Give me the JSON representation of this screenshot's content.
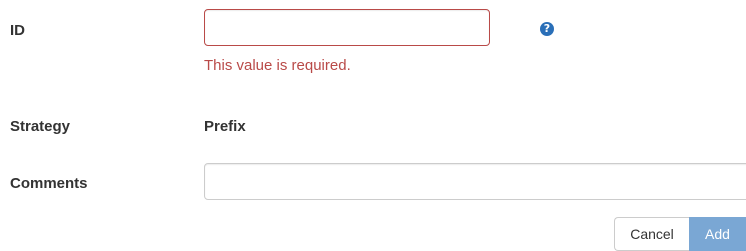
{
  "form": {
    "id": {
      "label": "ID",
      "value": "",
      "error": "This value is required.",
      "help_icon_glyph": "?"
    },
    "strategy": {
      "label": "Strategy",
      "value": "Prefix"
    },
    "comments": {
      "label": "Comments",
      "value": ""
    }
  },
  "actions": {
    "cancel_label": "Cancel",
    "add_label": "Add"
  },
  "colors": {
    "error": "#b94a48",
    "primary_disabled": "#7aa7d4",
    "help_icon": "#2a6fb8"
  }
}
